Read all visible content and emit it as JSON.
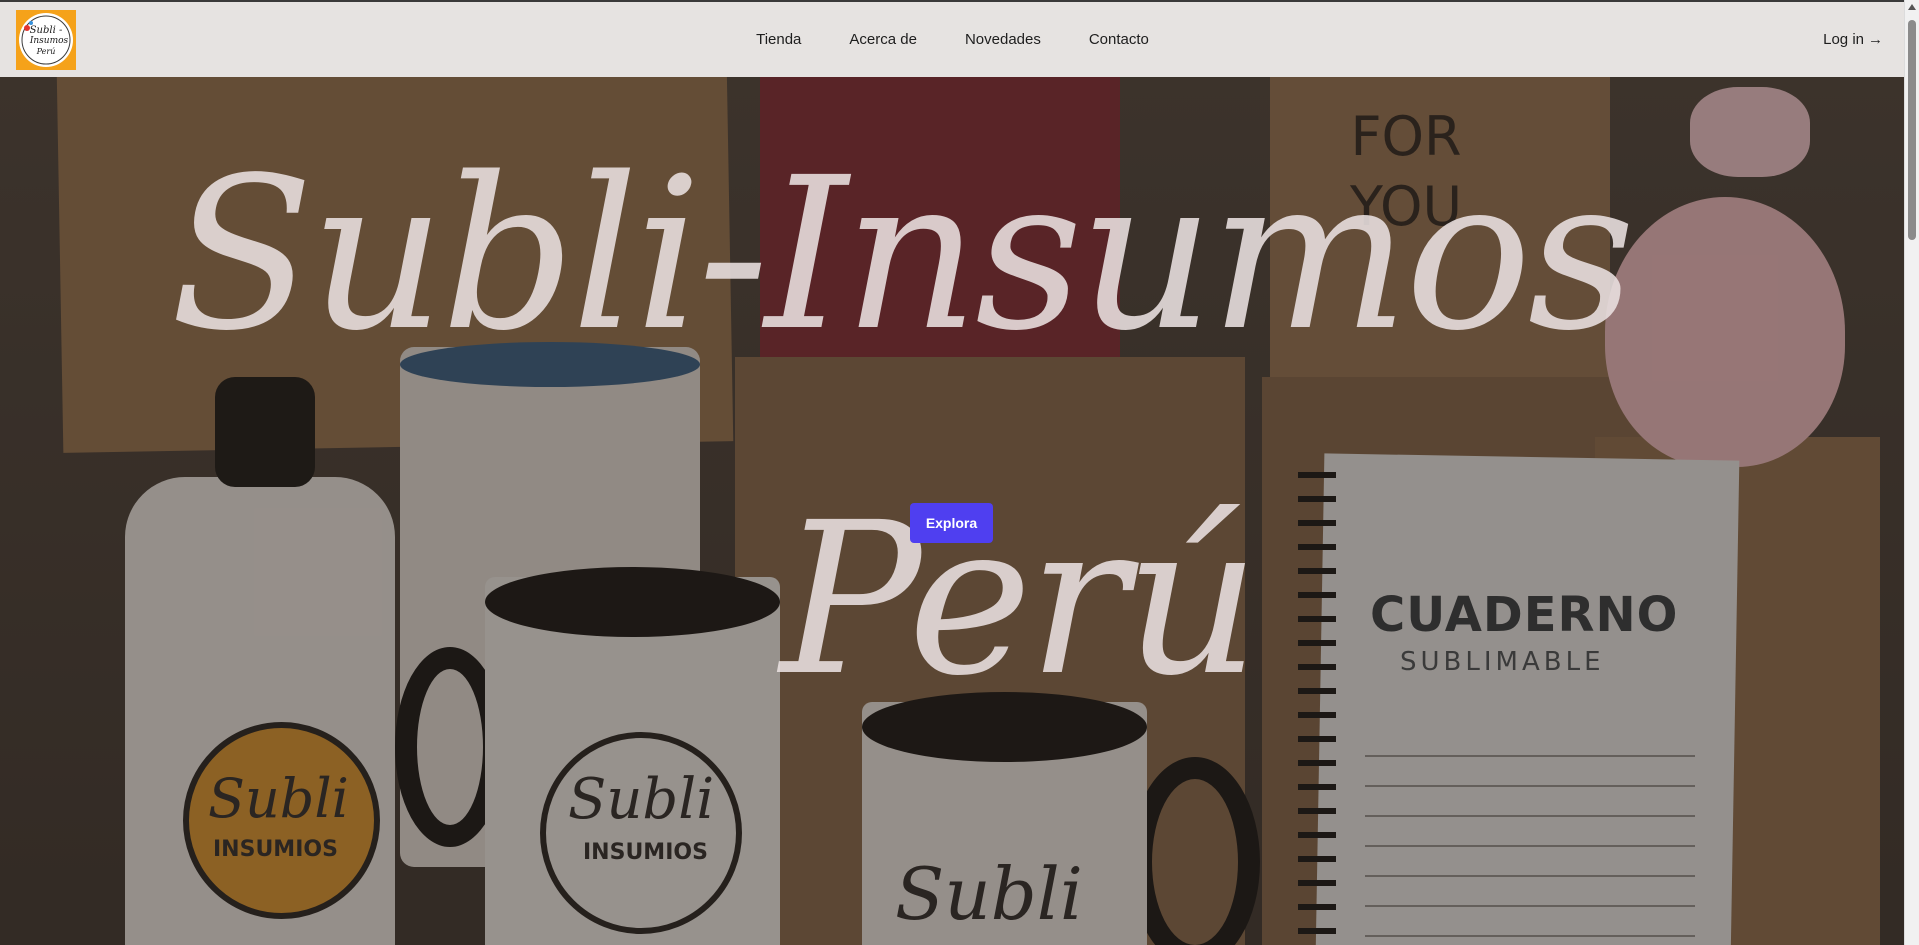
{
  "header": {
    "logo_text": "Subli - Insumos Perú",
    "nav": [
      {
        "label": "Tienda"
      },
      {
        "label": "Acerca de"
      },
      {
        "label": "Novedades"
      },
      {
        "label": "Contacto"
      }
    ],
    "login_label": "Log in",
    "login_arrow": "→"
  },
  "hero": {
    "title_line1": "Subli-Insumos",
    "title_line2": "Perú",
    "cta_label": "Explora",
    "box_text_line1": "FOR",
    "box_text_line2": "YOU",
    "notebook_title": "CUADERNO",
    "notebook_subtitle": "SUBLIMABLE",
    "bottle_emblem_main": "Subli",
    "bottle_emblem_sub": "INSUMIOS",
    "mug_emblem_main": "Subli",
    "mug_emblem_sub": "INSUMIOS",
    "mug2_text": "Subli"
  },
  "colors": {
    "accent": "#4f3ff0",
    "navbar_bg": "#e6e3e1",
    "logo_bg": "#f5a21a"
  }
}
